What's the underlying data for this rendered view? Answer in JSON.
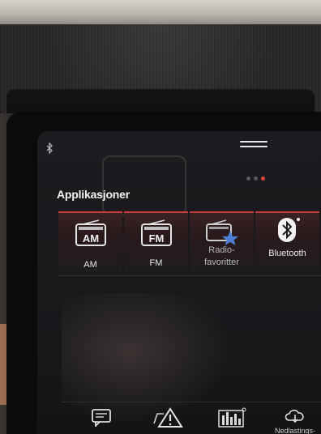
{
  "header": {
    "title": "Applikasjoner"
  },
  "pager": {
    "pages": 3,
    "active": 3
  },
  "apps": [
    {
      "id": "am",
      "label": "AM",
      "icon": "radio-am-icon",
      "icon_text": "AM"
    },
    {
      "id": "fm",
      "label": "FM",
      "icon": "radio-fm-icon",
      "icon_text": "FM"
    },
    {
      "id": "radio_favorites",
      "label_line1": "Radio-",
      "label_line2": "favoritter",
      "icon": "radio-favorites-icon"
    },
    {
      "id": "bluetooth",
      "label": "Bluetooth",
      "icon": "bluetooth-icon"
    }
  ],
  "bottom_bar": {
    "items": [
      {
        "id": "messages",
        "icon": "message-icon"
      },
      {
        "id": "warning",
        "icon": "car-warning-icon"
      },
      {
        "id": "equalizer",
        "icon": "equalizer-icon"
      },
      {
        "id": "downloads",
        "icon": "cloud-download-icon",
        "label": "Nedlastings-"
      }
    ]
  },
  "colors": {
    "accent": "#c6393c",
    "pager_active": "#e0473c",
    "screen_bg": "#1c1c20",
    "text": "#eaeaea"
  }
}
